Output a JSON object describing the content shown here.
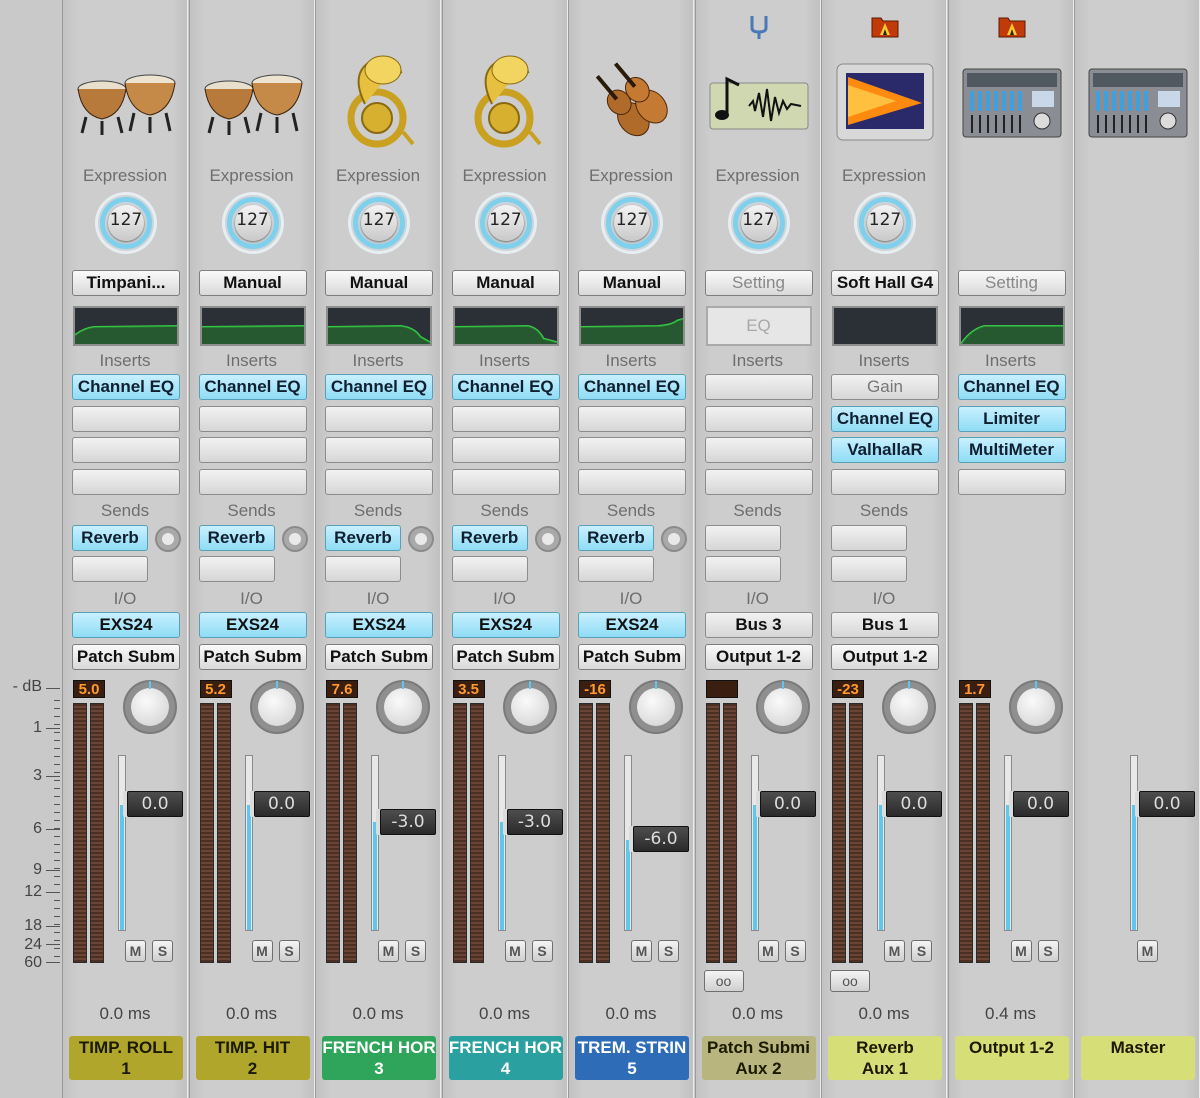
{
  "scale": {
    "unit_label": "- dB",
    "ticks": [
      "1",
      "3",
      "6",
      "9",
      "12",
      "18",
      "24",
      "60"
    ]
  },
  "labels": {
    "expression": "Expression",
    "inserts": "Inserts",
    "sends": "Sends",
    "io": "I/O",
    "eq_placeholder": "EQ",
    "mute": "M",
    "solo": "S",
    "link": "oo"
  },
  "channels": [
    {
      "icon": "timpani-icon",
      "has_folder": false,
      "has_tuner": false,
      "expression": "127",
      "setting": "Timpani...",
      "setting_gray": false,
      "eq": "eq-curve-1",
      "inserts": [
        "Channel EQ",
        "",
        "",
        ""
      ],
      "sends": [
        "Reverb",
        ""
      ],
      "send_knob": true,
      "input": "EXS24",
      "output": "Patch Subm",
      "peak": "5.0",
      "fader": "0.0",
      "fader_level": 0.72,
      "has_pan": true,
      "has_solo": true,
      "has_link": false,
      "delay": "0.0 ms",
      "name1": "TIMP. ROLL",
      "name2": "1",
      "color": "#b1a62c",
      "text_color": "#1a1a00"
    },
    {
      "icon": "timpani-icon",
      "has_folder": false,
      "has_tuner": false,
      "expression": "127",
      "setting": "Manual",
      "setting_gray": false,
      "eq": "eq-curve-2",
      "inserts": [
        "Channel EQ",
        "",
        "",
        ""
      ],
      "sends": [
        "Reverb",
        ""
      ],
      "send_knob": true,
      "input": "EXS24",
      "output": "Patch Subm",
      "peak": "5.2",
      "fader": "0.0",
      "fader_level": 0.72,
      "has_pan": true,
      "has_solo": true,
      "has_link": false,
      "delay": "0.0 ms",
      "name1": "TIMP. HIT",
      "name2": "2",
      "color": "#b1a62c",
      "text_color": "#1a1a00"
    },
    {
      "icon": "french-horn-icon",
      "has_folder": false,
      "has_tuner": false,
      "expression": "127",
      "setting": "Manual",
      "setting_gray": false,
      "eq": "eq-curve-3",
      "inserts": [
        "Channel EQ",
        "",
        "",
        ""
      ],
      "sends": [
        "Reverb",
        ""
      ],
      "send_knob": true,
      "input": "EXS24",
      "output": "Patch Subm",
      "peak": "7.6",
      "fader": "-3.0",
      "fader_level": 0.62,
      "has_pan": true,
      "has_solo": true,
      "has_link": false,
      "delay": "0.0 ms",
      "name1": "FRENCH HOR",
      "name2": "3",
      "color": "#2ea55a",
      "text_color": "#ffffff"
    },
    {
      "icon": "french-horn-icon",
      "has_folder": false,
      "has_tuner": false,
      "expression": "127",
      "setting": "Manual",
      "setting_gray": false,
      "eq": "eq-curve-4",
      "inserts": [
        "Channel EQ",
        "",
        "",
        ""
      ],
      "sends": [
        "Reverb",
        ""
      ],
      "send_knob": true,
      "input": "EXS24",
      "output": "Patch Subm",
      "peak": "3.5",
      "fader": "-3.0",
      "fader_level": 0.62,
      "has_pan": true,
      "has_solo": true,
      "has_link": false,
      "delay": "0.0 ms",
      "name1": "FRENCH HOR",
      "name2": "4",
      "color": "#2aa0a0",
      "text_color": "#ffffff"
    },
    {
      "icon": "violin-icon",
      "has_folder": false,
      "has_tuner": false,
      "expression": "127",
      "setting": "Manual",
      "setting_gray": false,
      "eq": "eq-curve-5",
      "inserts": [
        "Channel EQ",
        "",
        "",
        ""
      ],
      "sends": [
        "Reverb",
        ""
      ],
      "send_knob": true,
      "input": "EXS24",
      "output": "Patch Subm",
      "peak": "-16",
      "fader": "-6.0",
      "fader_level": 0.52,
      "has_pan": true,
      "has_solo": true,
      "has_link": false,
      "delay": "0.0 ms",
      "name1": "TREM. STRIN",
      "name2": "5",
      "color": "#2e6cb8",
      "text_color": "#ffffff"
    },
    {
      "icon": "audio-wave-icon",
      "has_folder": false,
      "has_tuner": true,
      "expression": "127",
      "setting": "Setting",
      "setting_gray": true,
      "eq": "empty",
      "inserts": [
        "",
        "",
        "",
        ""
      ],
      "sends": [
        "",
        ""
      ],
      "send_knob": false,
      "input": "Bus 3",
      "output": "Output 1-2",
      "peak": "",
      "fader": "0.0",
      "fader_level": 0.72,
      "has_pan": true,
      "has_solo": true,
      "has_link": true,
      "delay": "0.0 ms",
      "name1": "Patch Submi",
      "name2": "Aux 2",
      "color": "#b8b57e",
      "text_color": "#1a1a00"
    },
    {
      "icon": "space-designer-icon",
      "has_folder": true,
      "has_tuner": false,
      "expression": "127",
      "setting": "Soft Hall G4",
      "setting_gray": false,
      "eq": "eq-flat-dark",
      "inserts": [
        "Gain",
        "Channel EQ",
        "ValhallaR",
        ""
      ],
      "sends": [
        "",
        ""
      ],
      "send_knob": false,
      "input": "Bus 1",
      "output": "Output 1-2",
      "peak": "-23",
      "fader": "0.0",
      "fader_level": 0.72,
      "has_pan": true,
      "has_solo": true,
      "has_link": true,
      "delay": "0.0 ms",
      "name1": "Reverb",
      "name2": "Aux 1",
      "color": "#d6de78",
      "text_color": "#1a1a00"
    },
    {
      "icon": "mixing-console-icon",
      "has_folder": true,
      "has_tuner": false,
      "expression": "",
      "setting": "Setting",
      "setting_gray": true,
      "eq": "eq-curve-8",
      "inserts": [
        "Channel EQ",
        "Limiter",
        "MultiMeter",
        ""
      ],
      "sends": [],
      "send_knob": false,
      "input": "",
      "output": "",
      "peak": "1.7",
      "fader": "0.0",
      "fader_level": 0.72,
      "has_pan": true,
      "has_solo": true,
      "has_link": false,
      "delay": "0.4 ms",
      "name1": "Output 1-2",
      "name2": "",
      "color": "#d6de78",
      "text_color": "#1a1a00"
    },
    {
      "icon": "mixing-console-icon",
      "has_folder": false,
      "has_tuner": false,
      "expression": "",
      "setting": "",
      "setting_gray": false,
      "eq": "none",
      "inserts": [],
      "sends": [],
      "send_knob": false,
      "input": "",
      "output": "",
      "peak": "",
      "fader": "0.0",
      "fader_level": 0.72,
      "has_pan": false,
      "has_solo": false,
      "has_link": false,
      "delay": "",
      "name1": "Master",
      "name2": "",
      "color": "#d6de78",
      "text_color": "#1a1a00"
    }
  ]
}
